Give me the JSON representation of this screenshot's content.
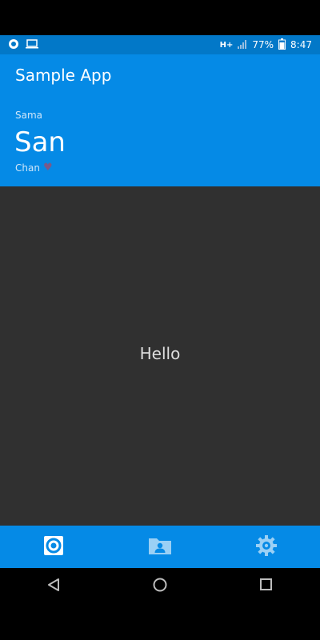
{
  "status_bar": {
    "network": "H+",
    "battery": "77%",
    "time": "8:47"
  },
  "app_bar": {
    "title": "Sample App",
    "small_label": "Sama",
    "large_label": "San",
    "footer_label": "Chan",
    "heart_icon": "heart-icon"
  },
  "content": {
    "text": "Hello"
  },
  "bottom_nav": {
    "items": [
      {
        "icon": "home-target-icon",
        "active": true
      },
      {
        "icon": "folder-person-icon",
        "active": false
      },
      {
        "icon": "settings-gear-icon",
        "active": false
      }
    ],
    "active_color": "#ffffff",
    "inactive_color": "#9ad0f5"
  },
  "system_nav": {
    "buttons": [
      "back-icon",
      "home-icon",
      "recents-icon"
    ]
  },
  "colors": {
    "primary": "#058ae6",
    "status": "#0278c8",
    "background": "#303030"
  }
}
